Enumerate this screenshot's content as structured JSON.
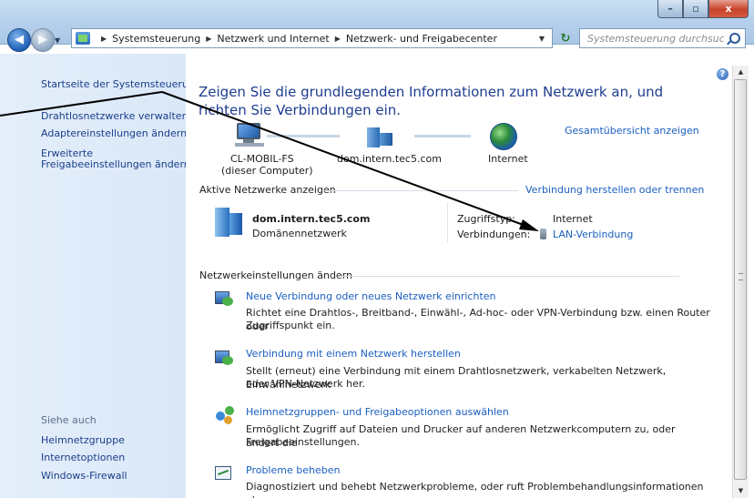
{
  "window": {
    "controls": {
      "minimize": "–",
      "maximize": "▫",
      "close": "x"
    }
  },
  "address": {
    "crumbs": [
      "Systemsteuerung",
      "Netzwerk und Internet",
      "Netzwerk- und Freigabecenter"
    ],
    "search_placeholder": "Systemsteuerung durchsuchen"
  },
  "sidebar": {
    "home": "Startseite der Systemsteuerung",
    "items": [
      "Drahtlosnetzwerke verwalten",
      "Adaptereinstellungen ändern",
      "Erweiterte",
      "Freigabeeinstellungen ändern"
    ],
    "see_also_head": "Siehe auch",
    "see_also": [
      "Heimnetzgruppe",
      "Internetoptionen",
      "Windows-Firewall"
    ]
  },
  "main": {
    "title": "Zeigen Sie die grundlegenden Informationen zum Netzwerk an, und richten Sie Verbindungen ein.",
    "full_map_link": "Gesamtübersicht anzeigen",
    "nodes": {
      "computer": "CL-MOBIL-FS",
      "computer_sub": "(dieser Computer)",
      "domain": "dom.intern.tec5.com",
      "internet": "Internet"
    },
    "active_networks_head": "Aktive Netzwerke anzeigen",
    "connect_link": "Verbindung herstellen oder trennen",
    "network": {
      "name": "dom.intern.tec5.com",
      "type": "Domänennetzwerk",
      "access_label": "Zugriffstyp:",
      "access_value": "Internet",
      "connections_label": "Verbindungen:",
      "connections_value": "LAN-Verbindung"
    },
    "settings_head": "Netzwerkeinstellungen ändern",
    "tasks": [
      {
        "title": "Neue Verbindung oder neues Netzwerk einrichten",
        "desc1": "Richtet eine Drahtlos-, Breitband-, Einwähl-, Ad-hoc- oder VPN-Verbindung bzw. einen Router oder",
        "desc2": "Zugriffspunkt ein."
      },
      {
        "title": "Verbindung mit einem Netzwerk herstellen",
        "desc1": "Stellt (erneut) eine Verbindung mit einem Drahtlosnetzwerk, verkabelten Netzwerk, Einwählnetzwerk",
        "desc2": "oder VPN-Netzwerk her."
      },
      {
        "title": "Heimnetzgruppen- und Freigabeoptionen auswählen",
        "desc1": "Ermöglicht Zugriff auf Dateien und Drucker auf anderen Netzwerkcomputern zu, oder ändert die",
        "desc2": "Freigabeeinstellungen."
      },
      {
        "title": "Probleme beheben",
        "desc1": "Diagnostiziert und behebt Netzwerkprobleme, oder ruft Problembehandlungsinformationen ab.",
        "desc2": ""
      }
    ]
  },
  "help": "?"
}
